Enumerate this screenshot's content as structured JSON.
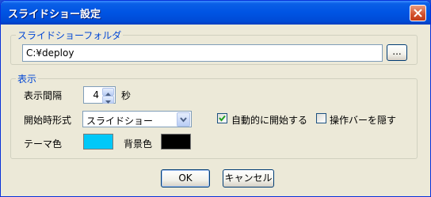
{
  "window": {
    "title": "スライドショー設定"
  },
  "folder_group": {
    "legend": "スライドショーフォルダ",
    "path_value": "C:¥deploy",
    "browse_label": "..."
  },
  "display_group": {
    "legend": "表示",
    "interval_label": "表示間隔",
    "interval_value": "4",
    "interval_unit": "秒",
    "start_format_label": "開始時形式",
    "start_format_value": "スライドショー",
    "auto_start_label": "自動的に開始する",
    "auto_start_checked": true,
    "hide_toolbar_label": "操作バーを隠す",
    "hide_toolbar_checked": false,
    "theme_color_label": "テーマ色",
    "theme_color": "#00c8f8",
    "bg_color_label": "背景色",
    "bg_color": "#000000"
  },
  "buttons": {
    "ok": "OK",
    "cancel": "キャンセル"
  }
}
